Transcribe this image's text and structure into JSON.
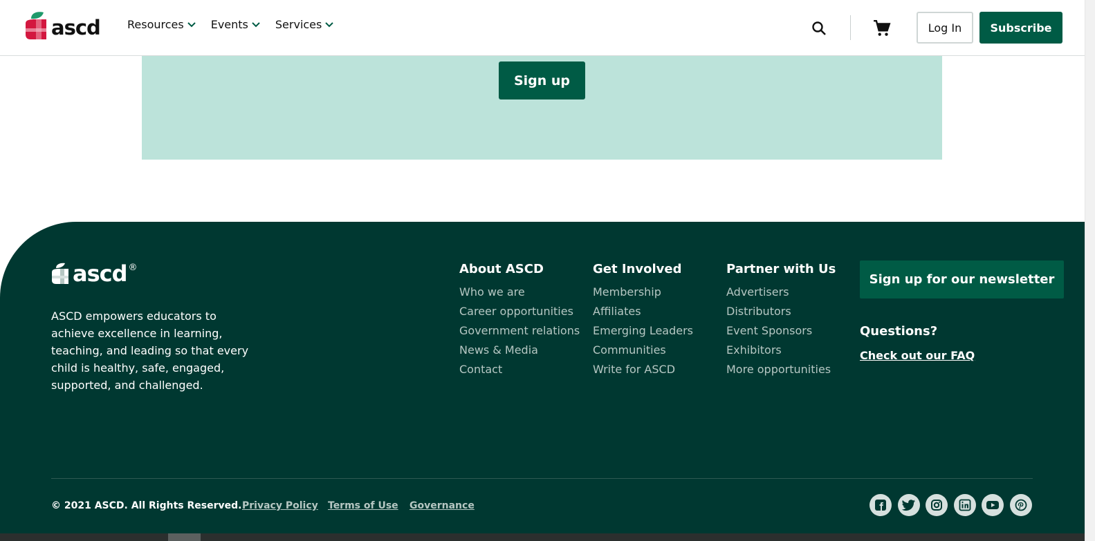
{
  "header": {
    "logo_text": "ascd",
    "nav": [
      {
        "label": "Resources"
      },
      {
        "label": "Events"
      },
      {
        "label": "Services"
      }
    ],
    "search_icon": "search-icon",
    "cart_icon": "cart-icon",
    "login_label": "Log In",
    "subscribe_label": "Subscribe"
  },
  "band": {
    "signup_label": "Sign up",
    "background": "#bce3da"
  },
  "footer": {
    "logo_text": "ascd",
    "logo_reg": "®",
    "description": "ASCD empowers educators to achieve excellence in learning, teaching, and leading so that every child is healthy, safe, engaged, supported, and challenged.",
    "columns": [
      {
        "heading": "About ASCD",
        "links": [
          "Who we are",
          "Career opportunities",
          "Government relations",
          "News & Media",
          "Contact"
        ]
      },
      {
        "heading": "Get Involved",
        "links": [
          "Membership",
          "Affiliates",
          "Emerging Leaders",
          "Communities",
          "Write for ASCD"
        ]
      },
      {
        "heading": "Partner with Us",
        "links": [
          "Advertisers",
          "Distributors",
          "Event Sponsors",
          "Exhibitors",
          "More opportunities"
        ]
      }
    ],
    "newsletter_label": "Sign up for our newsletter",
    "questions_label": "Questions?",
    "faq_label": "Check out our FAQ",
    "copyright": "© 2021 ASCD. All Rights Reserved.",
    "legal": {
      "privacy": "Privacy Policy",
      "terms": "Terms of Use",
      "governance": "Governance"
    },
    "socials": [
      "facebook-icon",
      "twitter-icon",
      "instagram-icon",
      "linkedin-icon",
      "youtube-icon",
      "pinterest-icon"
    ]
  },
  "colors": {
    "brand_green": "#005b45",
    "footer_bg": "#003831",
    "link_muted": "#b6c7c3",
    "logo_red": "#d3173f",
    "logo_leaf": "#1f9a6b"
  }
}
